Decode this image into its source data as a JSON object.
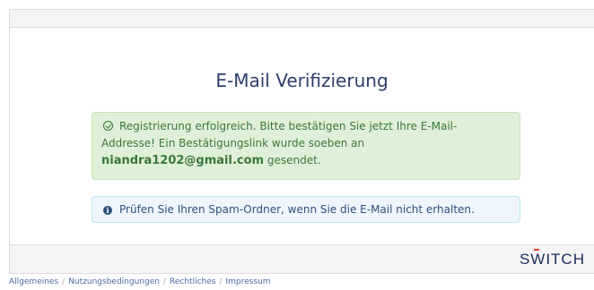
{
  "page": {
    "title": "E-Mail Verifizierung"
  },
  "success_alert": {
    "text_before": "Registrierung erfolgreich. Bitte bestätigen Sie jetzt Ihre E-Mail-Addresse! Ein Bestätigungslink wurde soeben an",
    "email": "niandra1202@gmail.com",
    "text_after": "gesendet.",
    "icon": "check-circle-icon"
  },
  "info_alert": {
    "text": "Prüfen Sie Ihren Spam-Ordner, wenn Sie die E-Mail nicht erhalten.",
    "icon": "info-circle-icon"
  },
  "logo": {
    "part1": "S",
    "part2": "W",
    "part3": "ITCH"
  },
  "footer": {
    "links": [
      "Allgemeines",
      "Nutzungsbedingungen",
      "Rechtliches",
      "Impressum"
    ],
    "separator": "/"
  }
}
